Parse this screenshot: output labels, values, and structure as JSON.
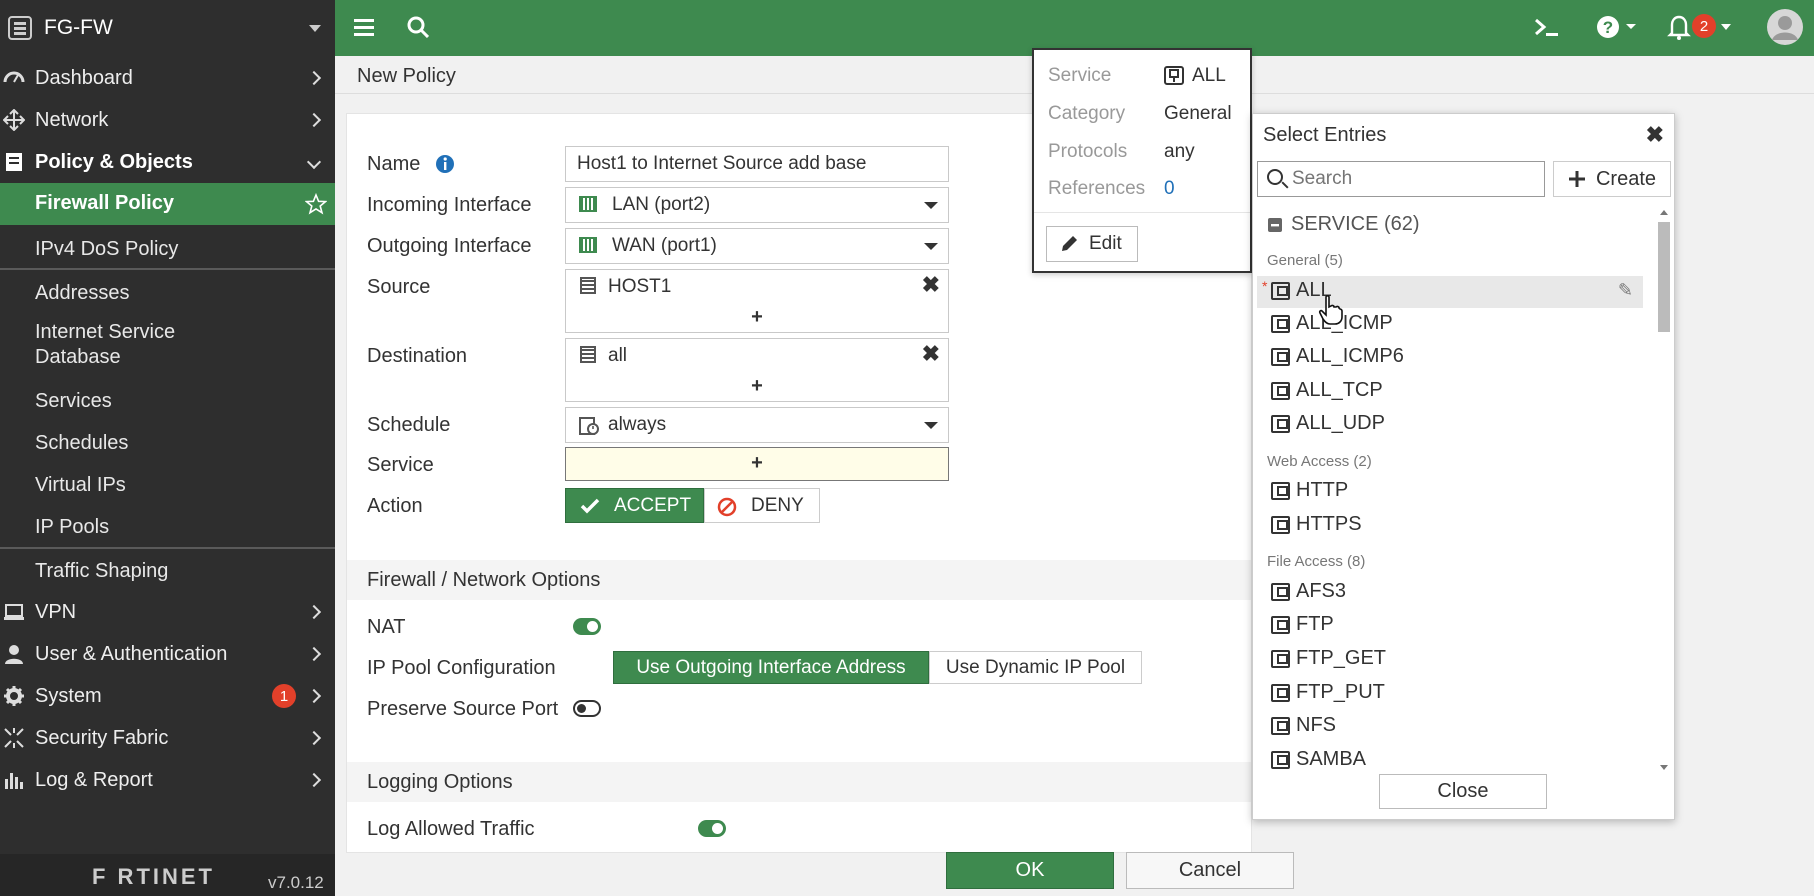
{
  "sidebar": {
    "device_name": "FG-FW",
    "items": {
      "dashboard": "Dashboard",
      "network": "Network",
      "policy_objects": "Policy & Objects",
      "firewall_policy": "Firewall Policy",
      "ipv4_dos": "IPv4 DoS Policy",
      "addresses": "Addresses",
      "isdb": "Internet Service Database",
      "services": "Services",
      "schedules": "Schedules",
      "virtual_ips": "Virtual IPs",
      "ip_pools": "IP Pools",
      "traffic_shaping": "Traffic Shaping",
      "vpn": "VPN",
      "user_auth": "User & Authentication",
      "system": "System",
      "system_badge": "1",
      "security_fabric": "Security Fabric",
      "log_report": "Log & Report"
    },
    "brand": "F RTINET",
    "version": "v7.0.12"
  },
  "topbar": {
    "notif_count": "2",
    "icons": [
      "menu-icon",
      "search-icon",
      "cli-console-icon",
      "help-icon",
      "bell-icon",
      "user-avatar-icon"
    ]
  },
  "page": {
    "title": "New Policy"
  },
  "form": {
    "name_label": "Name",
    "name_value": "Host1 to Internet Source add base",
    "incoming_label": "Incoming Interface",
    "incoming_value": "LAN (port2)",
    "outgoing_label": "Outgoing Interface",
    "outgoing_value": "WAN (port1)",
    "source_label": "Source",
    "source_value": "HOST1",
    "destination_label": "Destination",
    "destination_value": "all",
    "schedule_label": "Schedule",
    "schedule_value": "always",
    "service_label": "Service",
    "action_label": "Action",
    "accept_label": "ACCEPT",
    "deny_label": "DENY",
    "plus": "+"
  },
  "firewall_options": {
    "section_title": "Firewall / Network Options",
    "nat_label": "NAT",
    "nat_on": true,
    "ippool_label": "IP Pool Configuration",
    "ippool_opt1": "Use Outgoing Interface Address",
    "ippool_opt2": "Use Dynamic IP Pool",
    "preserve_label": "Preserve Source Port",
    "preserve_on": false
  },
  "logging": {
    "section_title": "Logging Options",
    "log_allowed_label": "Log Allowed Traffic",
    "log_allowed_on": true
  },
  "footer_buttons": {
    "ok": "OK",
    "cancel": "Cancel"
  },
  "tooltip": {
    "service_key": "Service",
    "service_val": "ALL",
    "category_key": "Category",
    "category_val": "General",
    "protocols_key": "Protocols",
    "protocols_val": "any",
    "references_key": "References",
    "references_val": "0",
    "edit_label": "Edit"
  },
  "select_entries": {
    "title": "Select Entries",
    "search_placeholder": "Search",
    "create_label": "Create",
    "group_label": "SERVICE (62)",
    "categories": {
      "general": "General (5)",
      "web": "Web Access (2)",
      "file": "File Access (8)"
    },
    "entries": {
      "all": "ALL",
      "all_icmp": "ALL_ICMP",
      "all_icmp6": "ALL_ICMP6",
      "all_tcp": "ALL_TCP",
      "all_udp": "ALL_UDP",
      "http": "HTTP",
      "https": "HTTPS",
      "afs3": "AFS3",
      "ftp": "FTP",
      "ftp_get": "FTP_GET",
      "ftp_put": "FTP_PUT",
      "nfs": "NFS",
      "samba": "SAMBA"
    },
    "close_label": "Close"
  },
  "colors": {
    "accent_green": "#3e8a4f",
    "sidebar_bg": "#2e2e2e",
    "badge_red": "#e2402a",
    "service_field_bg": "#fffde8"
  }
}
